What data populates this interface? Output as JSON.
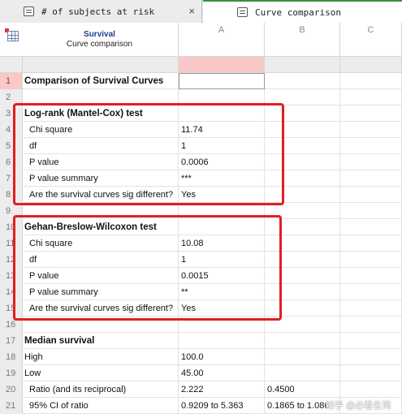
{
  "tabs": [
    {
      "label": "# of subjects at risk",
      "close": "×",
      "active": false
    },
    {
      "label": "Curve comparison",
      "active": true
    }
  ],
  "sheet": {
    "title": "Survival",
    "subtitle": "Curve comparison"
  },
  "columns": [
    "A",
    "B",
    "C"
  ],
  "rows": [
    {
      "num": "1",
      "label": "Comparison of Survival Curves",
      "a": "",
      "b": "",
      "bold": true,
      "indent": false
    },
    {
      "num": "2",
      "label": "",
      "a": "",
      "b": "",
      "bold": false,
      "indent": false
    },
    {
      "num": "3",
      "label": "Log-rank (Mantel-Cox) test",
      "a": "",
      "b": "",
      "bold": true,
      "indent": false
    },
    {
      "num": "4",
      "label": "Chi square",
      "a": "11.74",
      "b": "",
      "bold": false,
      "indent": true
    },
    {
      "num": "5",
      "label": "df",
      "a": "1",
      "b": "",
      "bold": false,
      "indent": true
    },
    {
      "num": "6",
      "label": "P value",
      "a": "0.0006",
      "b": "",
      "bold": false,
      "indent": true
    },
    {
      "num": "7",
      "label": "P value summary",
      "a": "***",
      "b": "",
      "bold": false,
      "indent": true
    },
    {
      "num": "8",
      "label": "Are the survival curves sig different?",
      "a": "Yes",
      "b": "",
      "bold": false,
      "indent": true
    },
    {
      "num": "9",
      "label": "",
      "a": "",
      "b": "",
      "bold": false,
      "indent": false
    },
    {
      "num": "10",
      "label": "Gehan-Breslow-Wilcoxon test",
      "a": "",
      "b": "",
      "bold": true,
      "indent": false
    },
    {
      "num": "11",
      "label": "Chi square",
      "a": "10.08",
      "b": "",
      "bold": false,
      "indent": true
    },
    {
      "num": "12",
      "label": "df",
      "a": "1",
      "b": "",
      "bold": false,
      "indent": true
    },
    {
      "num": "13",
      "label": "P value",
      "a": "0.0015",
      "b": "",
      "bold": false,
      "indent": true
    },
    {
      "num": "14",
      "label": "P value summary",
      "a": "**",
      "b": "",
      "bold": false,
      "indent": true
    },
    {
      "num": "15",
      "label": "Are the survival curves sig different?",
      "a": "Yes",
      "b": "",
      "bold": false,
      "indent": true
    },
    {
      "num": "16",
      "label": "",
      "a": "",
      "b": "",
      "bold": false,
      "indent": false
    },
    {
      "num": "17",
      "label": "Median survival",
      "a": "",
      "b": "",
      "bold": true,
      "indent": false
    },
    {
      "num": "18",
      "label": "High",
      "a": "100.0",
      "b": "",
      "bold": false,
      "indent": false
    },
    {
      "num": "19",
      "label": "Low",
      "a": "45.00",
      "b": "",
      "bold": false,
      "indent": false
    },
    {
      "num": "20",
      "label": "Ratio (and its reciprocal)",
      "a": "2.222",
      "b": "0.4500",
      "bold": false,
      "indent": true
    },
    {
      "num": "21",
      "label": "95% CI of ratio",
      "a": "0.9209 to 5.363",
      "b": "0.1865 to 1.086",
      "bold": false,
      "indent": true
    }
  ],
  "watermark": "知乎 @必看名词",
  "colors": {
    "highlight": "#e02020",
    "selected_header": "#f7c9c9",
    "sheet_title": "#1b3f8f"
  }
}
